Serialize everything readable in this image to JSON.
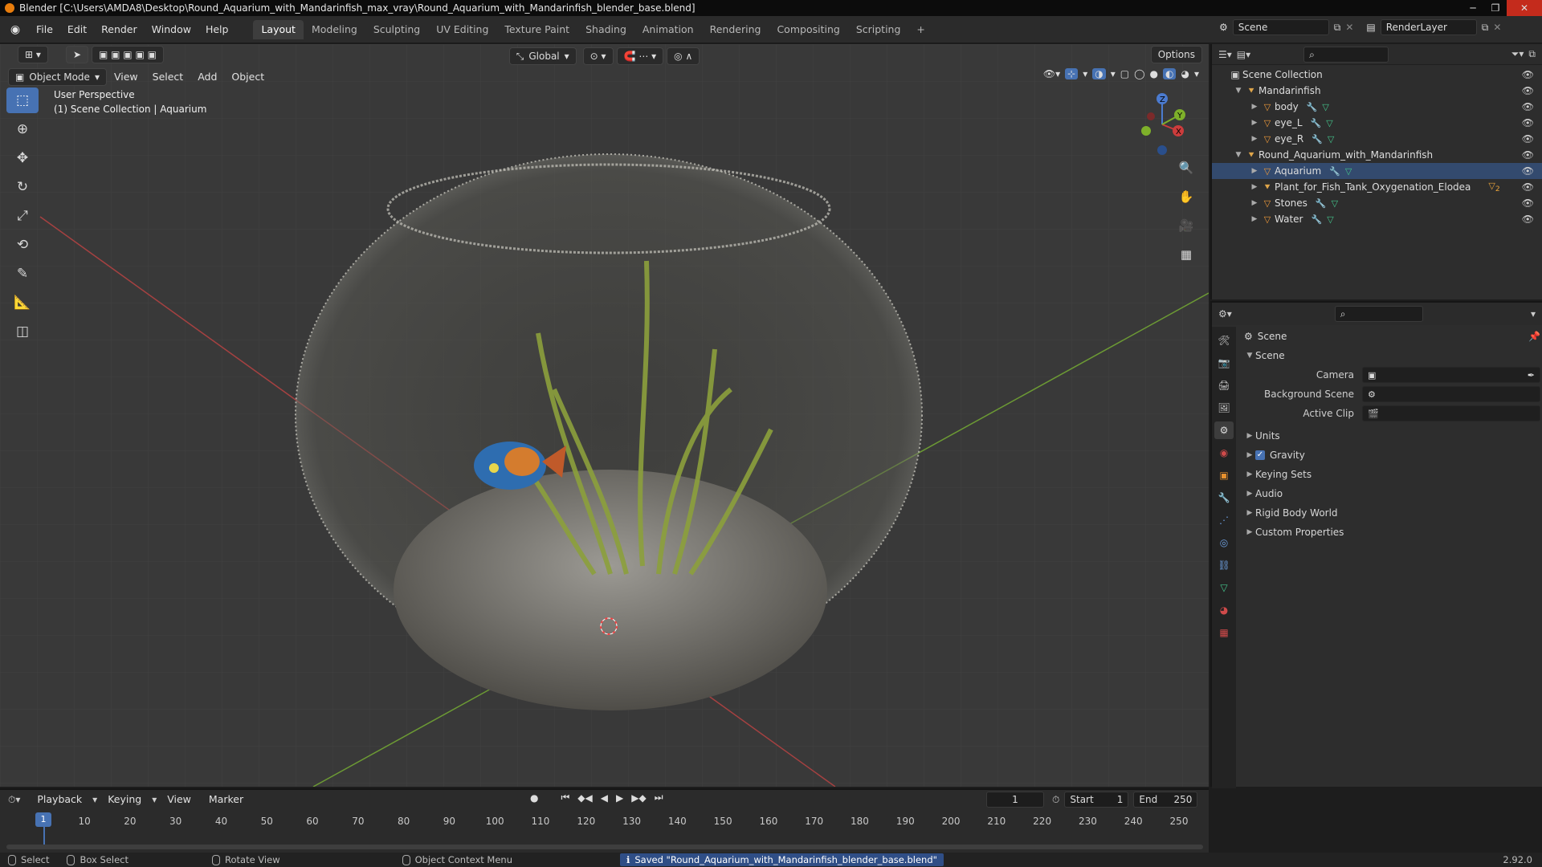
{
  "window": {
    "title": "Blender [C:\\Users\\AMDA8\\Desktop\\Round_Aquarium_with_Mandarinfish_max_vray\\Round_Aquarium_with_Mandarinfish_blender_base.blend]",
    "min": "─",
    "max": "❐",
    "close": "✕"
  },
  "menu": [
    "File",
    "Edit",
    "Render",
    "Window",
    "Help"
  ],
  "workspaces": [
    "Layout",
    "Modeling",
    "Sculpting",
    "UV Editing",
    "Texture Paint",
    "Shading",
    "Animation",
    "Rendering",
    "Compositing",
    "Scripting"
  ],
  "workspace_add": "+",
  "scene_field": "Scene",
  "renderlayer_field": "RenderLayer",
  "viewport": {
    "mode": "Object Mode",
    "menus": [
      "View",
      "Select",
      "Add",
      "Object"
    ],
    "transform": "Global",
    "options": "Options",
    "info_line1": "User Perspective",
    "info_line2": "(1) Scene Collection | Aquarium",
    "gizmo": {
      "x": "X",
      "y": "Y",
      "z": "Z"
    }
  },
  "outliner": {
    "root": "Scene Collection",
    "items": [
      {
        "label": "Mandarinfish",
        "level": 1,
        "type": "collection"
      },
      {
        "label": "body",
        "level": 2,
        "type": "mesh"
      },
      {
        "label": "eye_L",
        "level": 2,
        "type": "mesh"
      },
      {
        "label": "eye_R",
        "level": 2,
        "type": "mesh"
      },
      {
        "label": "Round_Aquarium_with_Mandarinfish",
        "level": 1,
        "type": "collection"
      },
      {
        "label": "Aquarium",
        "level": 2,
        "type": "mesh"
      },
      {
        "label": "Plant_for_Fish_Tank_Oxygenation_Elodea",
        "level": 2,
        "type": "collection"
      },
      {
        "label": "Stones",
        "level": 2,
        "type": "mesh"
      },
      {
        "label": "Water",
        "level": 2,
        "type": "mesh"
      }
    ],
    "plant_badge": "2"
  },
  "properties": {
    "header": "Scene",
    "panel": "Scene",
    "camera_label": "Camera",
    "bg_scene_label": "Background Scene",
    "active_clip_label": "Active Clip",
    "sections": [
      "Units",
      "Gravity",
      "Keying Sets",
      "Audio",
      "Rigid Body World",
      "Custom Properties"
    ]
  },
  "timeline": {
    "menus": [
      "Playback",
      "Keying",
      "View",
      "Marker"
    ],
    "current_frame": "1",
    "start_label": "Start",
    "start": "1",
    "end_label": "End",
    "end": "250",
    "ticks": [
      1,
      10,
      20,
      30,
      40,
      50,
      60,
      70,
      80,
      90,
      100,
      110,
      120,
      130,
      140,
      150,
      160,
      170,
      180,
      190,
      200,
      210,
      220,
      230,
      240,
      250
    ]
  },
  "status": {
    "select": "Select",
    "box_select": "Box Select",
    "rotate_view": "Rotate View",
    "context_menu": "Object Context Menu",
    "saved_msg": "Saved \"Round_Aquarium_with_Mandarinfish_blender_base.blend\"",
    "version": "2.92.0"
  },
  "colors": {
    "accent": "#4772b3",
    "orange": "#e87d0d",
    "x_axis": "#c94a4a",
    "y_axis": "#7cae3b"
  }
}
